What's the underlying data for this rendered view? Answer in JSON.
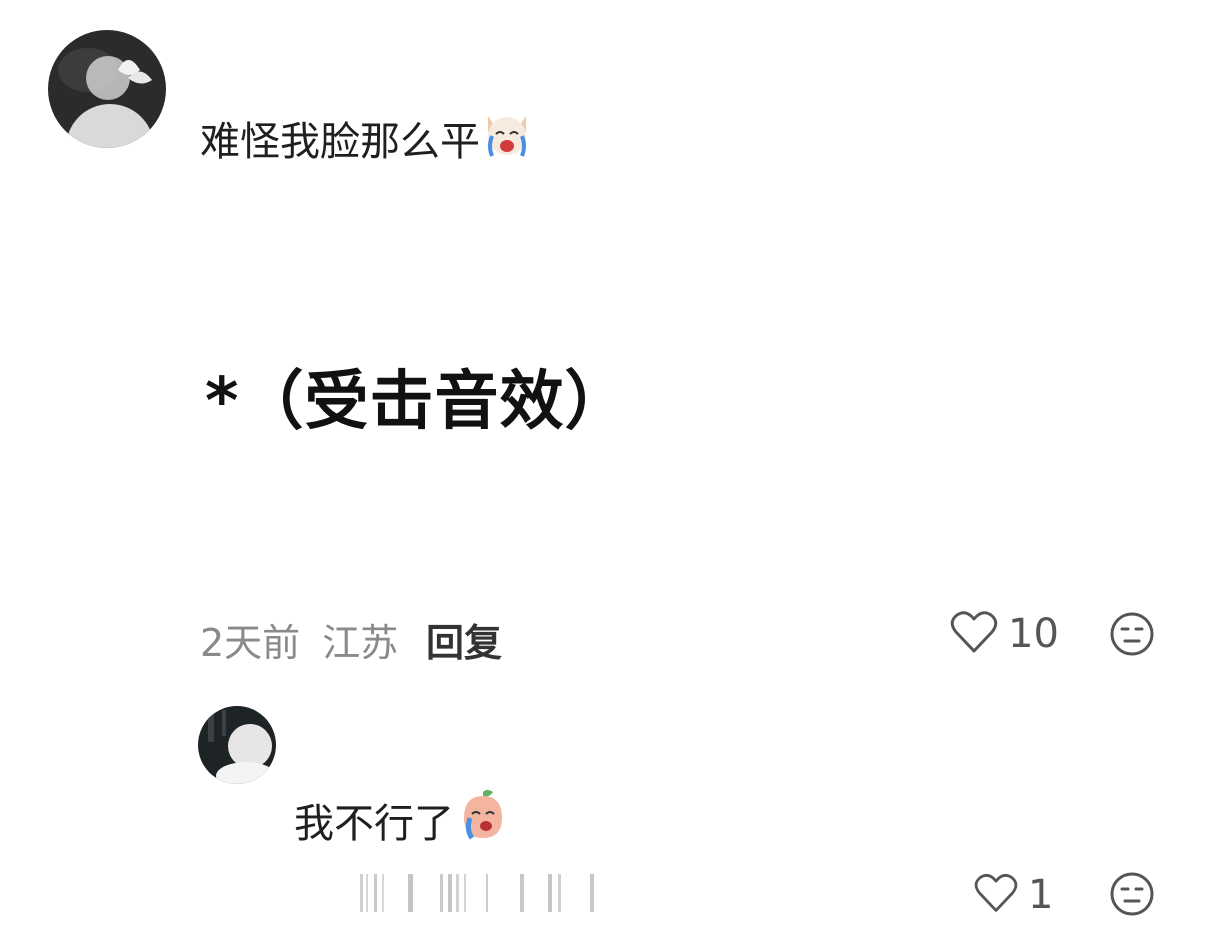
{
  "comment": {
    "text": "难怪我脸那么平",
    "emoji": "crying-dog-emoji",
    "image_text": "*（受击音效）",
    "time": "2天前",
    "location": "江苏",
    "reply_label": "回复",
    "likes": "10"
  },
  "reply": {
    "text": "我不行了",
    "emoji": "crying-peach-emoji",
    "likes": "1"
  },
  "colors": {
    "meta": "#8a8a8a",
    "icon": "#555555"
  }
}
